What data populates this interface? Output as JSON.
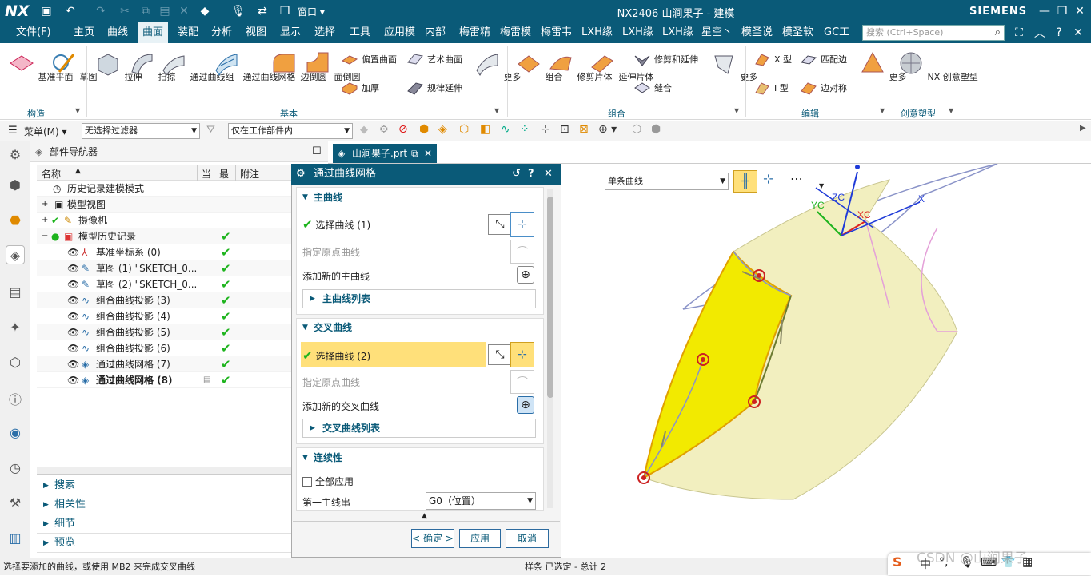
{
  "titlebar": {
    "logo": "NX",
    "title": "NX2406 山涧果子 - 建模",
    "brand": "SIEMENS",
    "window_menu": "窗口"
  },
  "menubar": {
    "items": [
      "文件(F)",
      "主页",
      "曲线",
      "曲面",
      "装配",
      "分析",
      "视图",
      "显示",
      "选择",
      "工具",
      "应用模",
      "内部",
      "梅雷精",
      "梅雷模",
      "梅雷韦",
      "LXH缘",
      "LXH缘",
      "LXH缘",
      "星空丶",
      "模圣说",
      "模圣软",
      "GC工"
    ],
    "active_index": 3,
    "search_placeholder": "搜索 (Ctrl+Space)"
  },
  "ribbon": {
    "build_items": [
      "基准平面",
      "草图"
    ],
    "build_label": "构造",
    "basic_items": [
      "拉伸",
      "扫掠",
      "通过曲线组",
      "通过曲线网格",
      "边倒圆",
      "面倒圆"
    ],
    "basic_small": [
      "偏置曲面",
      "加厚",
      "艺术曲面",
      "规律延伸"
    ],
    "more": "更多",
    "basic_label": "基本",
    "combine_items": [
      "组合",
      "修剪片体",
      "延伸片体"
    ],
    "combine_small": [
      "修剪和延伸",
      "缝合"
    ],
    "combine_label": "组合",
    "edit_small": [
      "X 型",
      "I 型",
      "匹配边",
      "边对称"
    ],
    "edit_label": "编辑",
    "creative_item": "NX 创意塑型",
    "creative_label": "创意塑型"
  },
  "toolbar": {
    "menu": "菜单(M)",
    "filter": "无选择过滤器",
    "scope": "仅在工作部件内"
  },
  "navigator": {
    "title": "部件导航器",
    "columns": [
      "名称",
      "当",
      "最",
      "附注"
    ],
    "rows": [
      {
        "label": "历史记录建模模式",
        "check": ""
      },
      {
        "label": "模型视图",
        "check": ""
      },
      {
        "label": "摄像机",
        "check": ""
      },
      {
        "label": "模型历史记录",
        "check": "✔"
      },
      {
        "label": "基准坐标系 (0)",
        "check": "✔"
      },
      {
        "label": "草图 (1) \"SKETCH_0...",
        "check": "✔"
      },
      {
        "label": "草图 (2) \"SKETCH_0...",
        "check": "✔"
      },
      {
        "label": "组合曲线投影 (3)",
        "check": "✔"
      },
      {
        "label": "组合曲线投影 (4)",
        "check": "✔"
      },
      {
        "label": "组合曲线投影 (5)",
        "check": "✔"
      },
      {
        "label": "组合曲线投影 (6)",
        "check": "✔"
      },
      {
        "label": "通过曲线网格 (7)",
        "check": "✔"
      },
      {
        "label": "通过曲线网格 (8)",
        "check": "✔"
      }
    ],
    "sections": [
      "搜索",
      "相关性",
      "细节",
      "预览"
    ]
  },
  "dialog": {
    "title": "通过曲线网格",
    "primary_header": "主曲线",
    "primary_select": "选择曲线 (1)",
    "primary_origin": "指定原点曲线",
    "primary_add": "添加新的主曲线",
    "primary_list": "主曲线列表",
    "cross_header": "交叉曲线",
    "cross_select": "选择曲线 (2)",
    "cross_origin": "指定原点曲线",
    "cross_add": "添加新的交叉曲线",
    "cross_list": "交叉曲线列表",
    "continuity_header": "连续性",
    "apply_all": "全部应用",
    "first_primary": "第一主线串",
    "first_primary_value": "G0（位置）",
    "ok": "< 确定 >",
    "apply": "应用",
    "cancel": "取消"
  },
  "tab": {
    "file": "山涧果子.prt"
  },
  "viewport": {
    "curve_rule": "单条曲线",
    "axes": [
      "YC",
      "ZC",
      "XC",
      "X"
    ]
  },
  "status": {
    "prompt": "选择要添加的曲线，或使用 MB2 来完成交叉曲线",
    "selection": "样条 已选定 - 总计 2",
    "watermark": "CSDN @山涧果子"
  },
  "colors": {
    "accent": "#0a5a78",
    "highlight": "#ffe07a",
    "surface": "#f2efbf",
    "check": "#1eb41e"
  }
}
